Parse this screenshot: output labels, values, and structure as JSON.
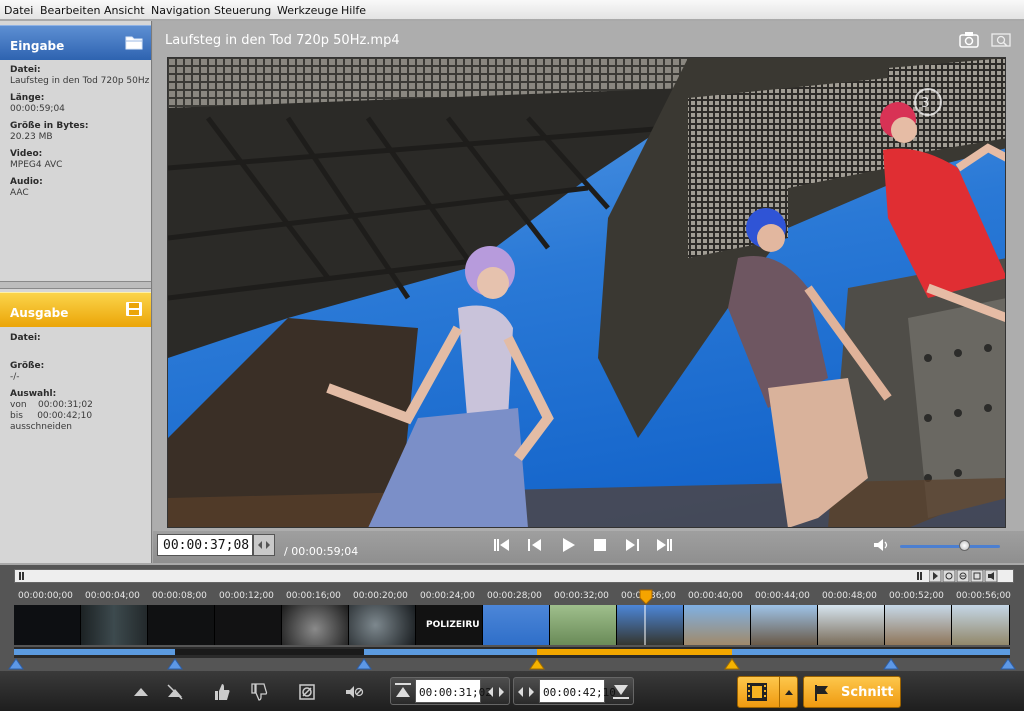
{
  "menu": [
    "Datei",
    "Bearbeiten",
    "Ansicht",
    "Navigation",
    "Steuerung",
    "Werkzeuge",
    "Hilfe"
  ],
  "eingabe": {
    "title": "Eingabe",
    "datei_label": "Datei:",
    "datei_value": "Laufsteg in den Tod 720p 50Hz",
    "laenge_label": "Länge:",
    "laenge_value": "00:00:59;04",
    "groesse_label": "Größe in Bytes:",
    "groesse_value": "20.23 MB",
    "video_label": "Video:",
    "video_value": "MPEG4 AVC",
    "audio_label": "Audio:",
    "audio_value": "AAC"
  },
  "ausgabe": {
    "title": "Ausgabe",
    "datei_label": "Datei:",
    "groesse_label": "Größe:",
    "groesse_value": "-/-",
    "auswahl_label": "Auswahl:",
    "von": "von    00:00:31;02",
    "bis": "bis     00:00:42;10",
    "aktion": "ausschneiden"
  },
  "video": {
    "title": "Laufsteg in den Tod 720p 50Hz.mp4",
    "current_time": "00:00:37;08",
    "duration": "/ 00:00:59;04",
    "volume_percent": 64
  },
  "timeline": {
    "ruler": [
      "00:00:00;00",
      "00:00:04;00",
      "00:00:08;00",
      "00:00:12;00",
      "00:00:16;00",
      "00:00:20;00",
      "00:00:24;00",
      "00:00:28;00",
      "00:00:32;00",
      "00:00:36;00",
      "00:00:40;00",
      "00:00:44;00",
      "00:00:48;00",
      "00:00:52;00",
      "00:00:56;00"
    ],
    "thumb_text": "POLIZEIRU"
  },
  "toolbar": {
    "start_time": "00:00:31;02",
    "end_time": "00:00:42;10",
    "cut_label": "Schnitt"
  },
  "icons": [
    "folder-icon",
    "save-icon",
    "camera-icon",
    "zoom-icon",
    "volume-icon",
    "thumb-up-icon",
    "thumb-down-icon",
    "mute-icon",
    "film-icon",
    "flag-icon"
  ],
  "colors": {
    "accent_blue": "#2e63b0",
    "accent_orange": "#eba508",
    "selection": "#f2a700"
  }
}
